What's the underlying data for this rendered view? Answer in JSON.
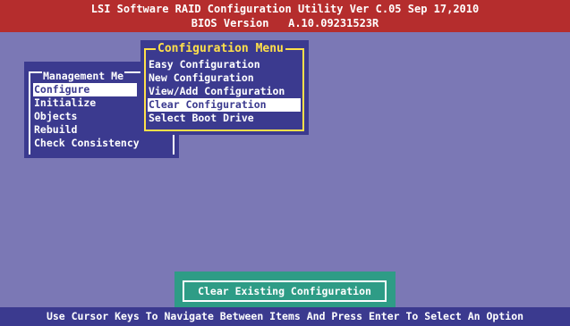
{
  "header": {
    "line1": "LSI Software RAID Configuration Utility Ver C.05 Sep 17,2010",
    "line2": "BIOS Version   A.10.09231523R"
  },
  "management_menu": {
    "title": "Management Me",
    "items": [
      {
        "label": "Configure",
        "selected": true
      },
      {
        "label": "Initialize",
        "selected": false
      },
      {
        "label": "Objects",
        "selected": false
      },
      {
        "label": "Rebuild",
        "selected": false
      },
      {
        "label": "Check Consistency",
        "selected": false
      }
    ]
  },
  "configuration_menu": {
    "title": "Configuration Menu",
    "items": [
      {
        "label": "Easy Configuration",
        "selected": false
      },
      {
        "label": "New Configuration",
        "selected": false
      },
      {
        "label": "View/Add Configuration",
        "selected": false
      },
      {
        "label": "Clear Configuration",
        "selected": true
      },
      {
        "label": "Select Boot Drive",
        "selected": false
      }
    ]
  },
  "status_box": {
    "text": "Clear Existing Configuration"
  },
  "footer": {
    "text": "Use Cursor Keys To Navigate Between Items And Press Enter To Select An Option"
  },
  "colors": {
    "background": "#7B78B5",
    "header": "#B52D2D",
    "menu": "#3B3A8F",
    "accent": "#FFE04A",
    "status": "#2E9C86"
  }
}
